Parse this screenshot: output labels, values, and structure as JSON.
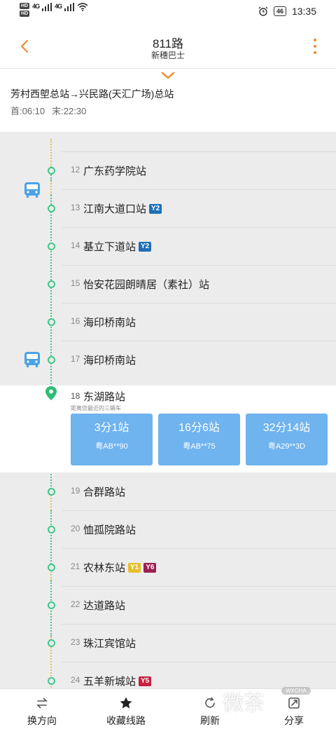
{
  "status": {
    "hd1": "HD",
    "hd2": "HD",
    "net1": "4G",
    "net2": "4G",
    "battery": "46",
    "time": "13:35"
  },
  "header": {
    "title": "811路",
    "subtitle": "新穗巴士"
  },
  "route": {
    "name": "芳村西塱总站→兴民路(天汇广场)总站",
    "first": "首:06:10",
    "last": "末:22:30"
  },
  "stops_before": [
    {
      "num": "12",
      "name": "广东药学院站",
      "badges": []
    },
    {
      "num": "13",
      "name": "江南大道口站",
      "badges": [
        {
          "text": "Y2",
          "color": "blue"
        }
      ]
    },
    {
      "num": "14",
      "name": "基立下道站",
      "badges": [
        {
          "text": "Y2",
          "color": "blue"
        }
      ]
    },
    {
      "num": "15",
      "name": "怡安花园朗晴居（素社）站",
      "badges": []
    },
    {
      "num": "16",
      "name": "海印桥南站",
      "badges": []
    },
    {
      "num": "17",
      "name": "海印桥南站",
      "badges": []
    }
  ],
  "current_stop": {
    "num": "18",
    "name": "东湖路站",
    "hint": "距离您最近的三辆车",
    "arrivals": [
      {
        "eta": "3分1站",
        "plate": "粤AB**90"
      },
      {
        "eta": "16分6站",
        "plate": "粤AB**75"
      },
      {
        "eta": "32分14站",
        "plate": "粤A29**3D"
      }
    ]
  },
  "stops_after": [
    {
      "num": "19",
      "name": "合群路站",
      "badges": []
    },
    {
      "num": "20",
      "name": "恤孤院路站",
      "badges": []
    },
    {
      "num": "21",
      "name": "农林东站",
      "badges": [
        {
          "text": "Y1",
          "color": "yellow"
        },
        {
          "text": "Y6",
          "color": "purple"
        }
      ]
    },
    {
      "num": "22",
      "name": "达道路站",
      "badges": []
    },
    {
      "num": "23",
      "name": "珠江宾馆站",
      "badges": []
    },
    {
      "num": "24",
      "name": "五羊新城站",
      "badges": [
        {
          "text": "Y5",
          "color": "red"
        }
      ]
    }
  ],
  "bottom_nav": [
    {
      "label": "换方向",
      "icon": "swap-icon"
    },
    {
      "label": "收藏线路",
      "icon": "star-icon"
    },
    {
      "label": "刷新",
      "icon": "refresh-icon"
    },
    {
      "label": "分享",
      "icon": "share-icon"
    }
  ],
  "watermark": {
    "text": "微茶",
    "tag": "WXCHA"
  },
  "colors": {
    "accent": "#f08a2c",
    "line": "#3ec98a",
    "card": "#6fb3ef"
  }
}
